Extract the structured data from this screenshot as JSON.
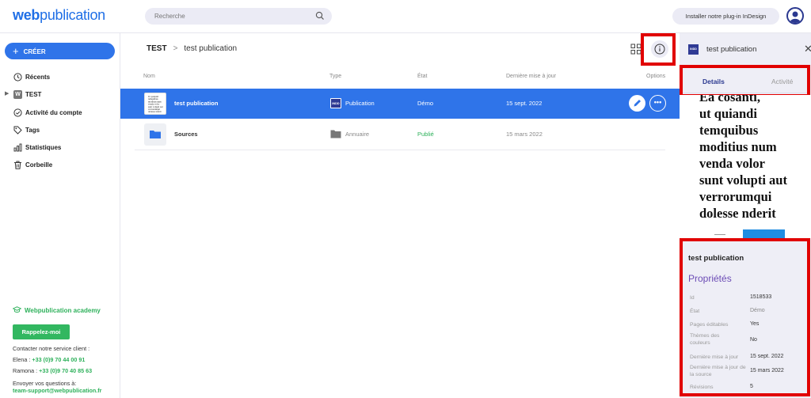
{
  "header": {
    "logo_bold": "web",
    "logo_rest": "publication",
    "search_placeholder": "Recherche",
    "plugin_button": "Installer notre plug-in InDesign"
  },
  "sidebar": {
    "create_label": "CRÉER",
    "items": [
      {
        "label": "Récents",
        "icon": "clock-icon"
      },
      {
        "label": "TEST",
        "icon": "workspace-badge",
        "badge": "W"
      },
      {
        "label": "Activité du compte",
        "icon": "check-circle-icon"
      },
      {
        "label": "Tags",
        "icon": "tag-icon"
      },
      {
        "label": "Statistiques",
        "icon": "bar-chart-icon"
      },
      {
        "label": "Corbeille",
        "icon": "trash-icon"
      }
    ],
    "academy": "Webpublication academy",
    "callback_button": "Rappelez-moi",
    "contact_title": "Contacter notre service client :",
    "contact_elena_label": "Elena : ",
    "contact_elena_phone": "+33 (0)9 70 44 00 91",
    "contact_ramona_label": "Ramona : ",
    "contact_ramona_phone": "+33 (0)9 70 40 85 63",
    "questions_label": "Envoyer vos questions à:",
    "support_email": "team-support@webpublication.fr"
  },
  "main": {
    "breadcrumb_root": "TEST",
    "breadcrumb_sep": ">",
    "breadcrumb_current": "test publication",
    "columns": {
      "name": "Nom",
      "type": "Type",
      "state": "État",
      "updated": "Dernière mise à jour",
      "options": "Options"
    },
    "rows": [
      {
        "name": "test publication",
        "type": "Publication",
        "state": "Démo",
        "updated": "15 sept. 2022",
        "selected": true
      },
      {
        "name": "Sources",
        "type": "Annuaire",
        "state": "Publié",
        "updated": "15 mars 2022",
        "selected": false
      }
    ],
    "more_glyph": "•••",
    "thumb_lines": [
      "Ut quiquid",
      "temquibus",
      "moditius num",
      "venda volor",
      "sunt volupti aut",
      "verrorumqui",
      "dolesse nderit"
    ]
  },
  "panel": {
    "title": "test publication",
    "tabs": {
      "details": "Details",
      "activity": "Activité"
    },
    "preview_text": "Ea cosanti,\nut quiandi\ntemquibus\nmoditius num\nvenda volor\nsunt volupti aut\nverrorumqui\ndolesse nderit",
    "pub_name": "test publication",
    "properties_title": "Propriétés",
    "properties": [
      {
        "key": "Id",
        "value": "1518533"
      },
      {
        "key": "État",
        "value": "Démo"
      },
      {
        "key": "Pages éditables",
        "value": "Yes"
      },
      {
        "key": "Thèmes des couleurs",
        "value": "No"
      },
      {
        "key": "Dernière mise à jour",
        "value": "15 sept. 2022"
      },
      {
        "key": "Dernière mise à jour de la source",
        "value": "15 mars 2022"
      },
      {
        "key": "Révisions",
        "value": "5"
      }
    ],
    "indd_label": "INDD"
  },
  "colors": {
    "accent": "#2f74e9",
    "brand_navy": "#2b3990",
    "green": "#2eb15b",
    "highlight_red": "#e10000",
    "properties_purple": "#6b4bb5"
  }
}
